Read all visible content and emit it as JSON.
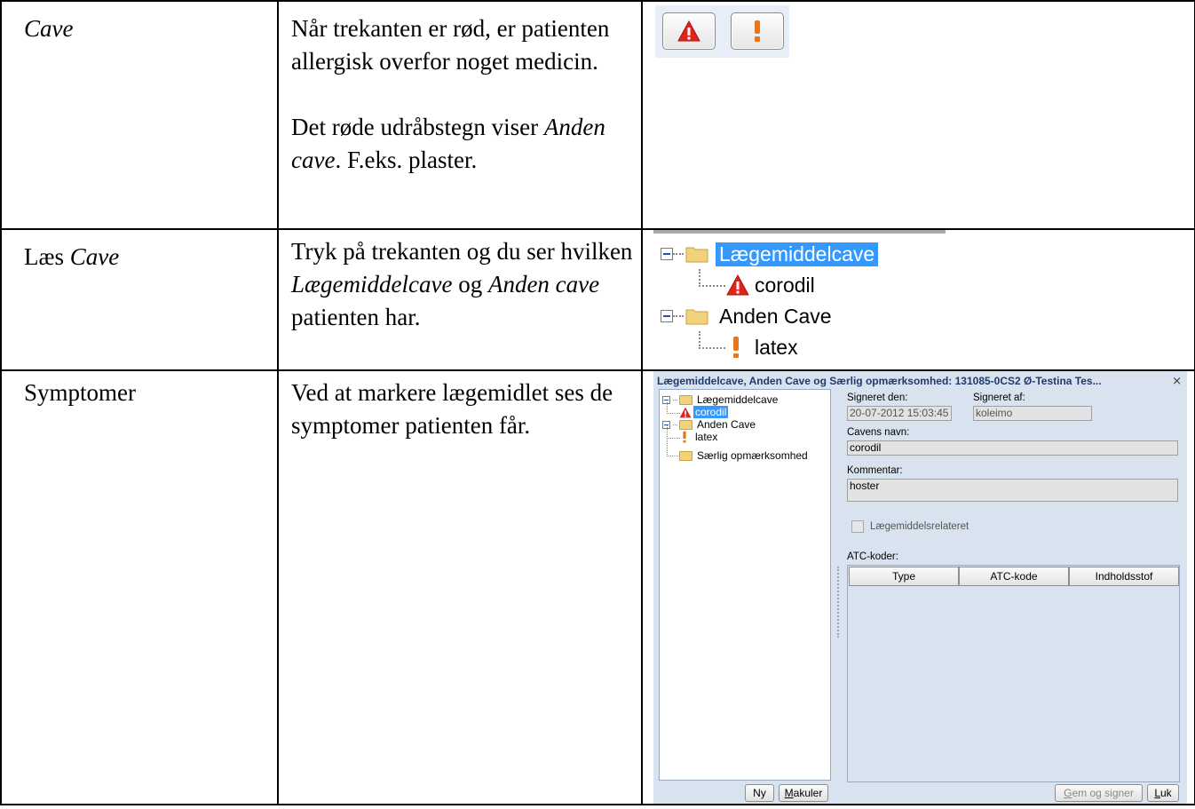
{
  "rows": [
    {
      "col1": "Cave",
      "col2_p1": "Når trekanten er rød, er patienten allergisk overfor noget medicin.",
      "col2_p2_em": "Anden cave",
      "col2_p2_pre": "Det røde udråbstegn viser ",
      "col2_p2_post": ". F.eks. plaster."
    },
    {
      "col1_pre": "Læs ",
      "col1_em": "Cave",
      "col2_pre": "Tryk på trekanten og du ser hvilken ",
      "col2_em1": "Lægemiddelcave",
      "col2_mid": " og ",
      "col2_em2": "Anden cave",
      "col2_post": " patienten har."
    },
    {
      "col1": "Symptomer",
      "col2": "Ved at markere lægemidlet ses de symptomer patienten får."
    }
  ],
  "tree": {
    "folder1": "Lægemiddelcave",
    "item1": "corodil",
    "folder2": "Anden Cave",
    "item2": "latex"
  },
  "dialog": {
    "title": "Lægemiddelcave, Anden Cave og Særlig opmærksomhed: 131085-0CS2 Ø-Testina Tes...",
    "close_glyph": "⨯",
    "tree": {
      "folder1": "Lægemiddelcave",
      "item1": "corodil",
      "folder2": "Anden Cave",
      "item2": "latex",
      "folder3": "Særlig opmærksomhed"
    },
    "signed_on_label": "Signeret den:",
    "signed_on_value": "20-07-2012 15:03:45",
    "signed_by_label": "Signeret af:",
    "signed_by_value": "koleimo",
    "name_label": "Cavens navn:",
    "name_value": "corodil",
    "comment_label": "Kommentar:",
    "comment_value": "hoster",
    "drug_related_label": "Lægemiddelsrelateret",
    "atc_label": "ATC-koder:",
    "columns": [
      "Type",
      "ATC-kode",
      "Indholdsstof"
    ],
    "btn_new": "Ny",
    "btn_cancel_pre": "",
    "btn_cancel_ul": "M",
    "btn_cancel_rest": "akuler",
    "btn_save_ul": "G",
    "btn_save_rest": "em og signer",
    "btn_close_ul": "L",
    "btn_close_rest": "uk"
  },
  "icons": {
    "warning": "warning-triangle-icon",
    "exclamation": "exclamation-icon",
    "warning_color": "#e3231b",
    "exclamation_color": "#e8751a",
    "selection_color": "#3399ff"
  }
}
